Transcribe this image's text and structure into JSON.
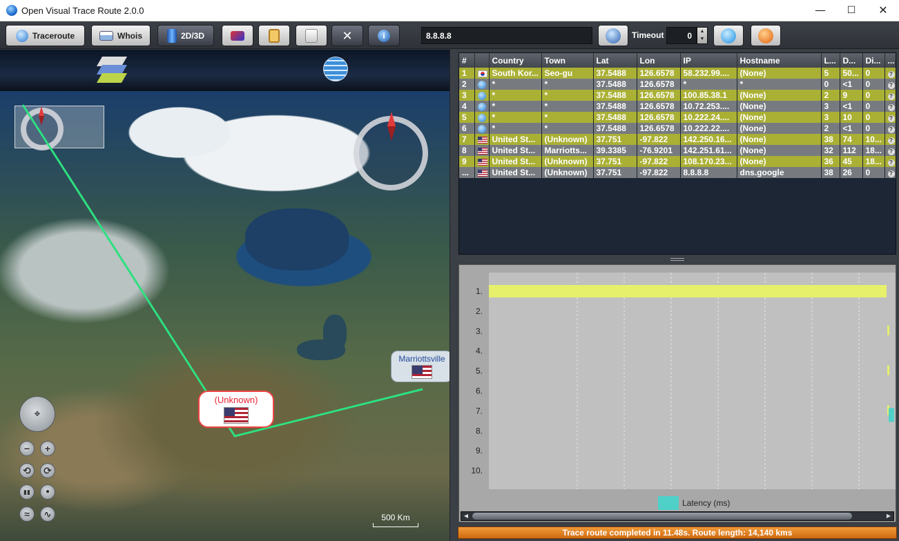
{
  "window": {
    "title": "Open Visual Trace Route 2.0.0",
    "minimize": "—",
    "maximize": "☐",
    "close": "✕"
  },
  "toolbar": {
    "traceroute_label": "Traceroute",
    "whois_label": "Whois",
    "mode_label": "2D/3D",
    "destination": "8.8.8.8",
    "timeout_label": "Timeout",
    "timeout_value": "0"
  },
  "map": {
    "labels": [
      {
        "text": "(Unknown)",
        "country": "United States"
      },
      {
        "text": "Marriottsville",
        "country": "United States"
      }
    ],
    "scale_label": "500 Km",
    "controls": [
      "−",
      "+",
      "⟲",
      "⟳",
      "▮▮",
      "●",
      "≈",
      "∿"
    ]
  },
  "table": {
    "columns": [
      "#",
      "",
      "Country",
      "Town",
      "Lat",
      "Lon",
      "IP",
      "Hostname",
      "L...",
      "D...",
      "Di...",
      "..."
    ],
    "rows": [
      {
        "num": "1",
        "flag": "kr",
        "country": "South Kor...",
        "town": "Seo-gu",
        "lat": "37.5488",
        "lon": "126.6578",
        "ip": "58.232.99....",
        "host": "(None)",
        "l": "5",
        "d": "50...",
        "di": "0",
        "hl": true
      },
      {
        "num": "2",
        "flag": "unk",
        "country": "*",
        "town": "*",
        "lat": "37.5488",
        "lon": "126.6578",
        "ip": "*",
        "host": "*",
        "l": "0",
        "d": "<1",
        "di": "0",
        "hl": false
      },
      {
        "num": "3",
        "flag": "unk",
        "country": "*",
        "town": "*",
        "lat": "37.5488",
        "lon": "126.6578",
        "ip": "100.85.38.1",
        "host": "(None)",
        "l": "2",
        "d": "9",
        "di": "0",
        "hl": true
      },
      {
        "num": "4",
        "flag": "unk",
        "country": "*",
        "town": "*",
        "lat": "37.5488",
        "lon": "126.6578",
        "ip": "10.72.253....",
        "host": "(None)",
        "l": "3",
        "d": "<1",
        "di": "0",
        "hl": false
      },
      {
        "num": "5",
        "flag": "unk",
        "country": "*",
        "town": "*",
        "lat": "37.5488",
        "lon": "126.6578",
        "ip": "10.222.24....",
        "host": "(None)",
        "l": "3",
        "d": "10",
        "di": "0",
        "hl": true
      },
      {
        "num": "6",
        "flag": "unk",
        "country": "*",
        "town": "*",
        "lat": "37.5488",
        "lon": "126.6578",
        "ip": "10.222.22....",
        "host": "(None)",
        "l": "2",
        "d": "<1",
        "di": "0",
        "hl": false
      },
      {
        "num": "7",
        "flag": "us",
        "country": "United St...",
        "town": "(Unknown)",
        "lat": "37.751",
        "lon": "-97.822",
        "ip": "142.250.16...",
        "host": "(None)",
        "l": "38",
        "d": "74",
        "di": "10...",
        "hl": true
      },
      {
        "num": "8",
        "flag": "us",
        "country": "United St...",
        "town": "Marriotts...",
        "lat": "39.3385",
        "lon": "-76.9201",
        "ip": "142.251.61...",
        "host": "(None)",
        "l": "32",
        "d": "112",
        "di": "18...",
        "hl": false
      },
      {
        "num": "9",
        "flag": "us",
        "country": "United St...",
        "town": "(Unknown)",
        "lat": "37.751",
        "lon": "-97.822",
        "ip": "108.170.23...",
        "host": "(None)",
        "l": "36",
        "d": "45",
        "di": "18...",
        "hl": true
      },
      {
        "num": "...",
        "flag": "us",
        "country": "United St...",
        "town": "(Unknown)",
        "lat": "37.751",
        "lon": "-97.822",
        "ip": "8.8.8.8",
        "host": "dns.google",
        "l": "38",
        "d": "26",
        "di": "0",
        "hl": false
      }
    ]
  },
  "chart": {
    "row_labels": [
      "1.",
      "2.",
      "3.",
      "4.",
      "5.",
      "6.",
      "7.",
      "8.",
      "9.",
      "10."
    ],
    "legend_label": "Latency (ms)",
    "colors": {
      "bar": "#e6f06a",
      "legend": "#4fd0c8",
      "plot_bg": "#c0c0c0"
    }
  },
  "status": {
    "text": "Trace route completed in 11.48s. Route length: 14,140 kms"
  }
}
